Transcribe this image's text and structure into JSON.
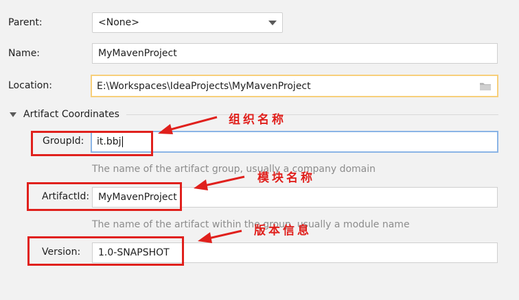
{
  "form": {
    "parent": {
      "label": "Parent:",
      "value": "<None>"
    },
    "name": {
      "label": "Name:",
      "value": "MyMavenProject"
    },
    "location": {
      "label": "Location:",
      "value": "E:\\Workspaces\\IdeaProjects\\MyMavenProject"
    }
  },
  "artifact": {
    "section_title": "Artifact Coordinates",
    "group_id": {
      "label": "GroupId:",
      "value": "it.bbj",
      "hint": "The name of the artifact group, usually a company domain"
    },
    "artifact_id": {
      "label": "ArtifactId:",
      "value": "MyMavenProject",
      "hint": "The name of the artifact within the group, usually a module name"
    },
    "version": {
      "label": "Version:",
      "value": "1.0-SNAPSHOT"
    }
  },
  "annotations": {
    "group": "组织名称",
    "artifact": "模块名称",
    "version": "版本信息"
  },
  "colors": {
    "annotation_red": "#e0201c",
    "focus_blue": "#8ab4e6",
    "focus_orange": "#f7cf7a"
  }
}
